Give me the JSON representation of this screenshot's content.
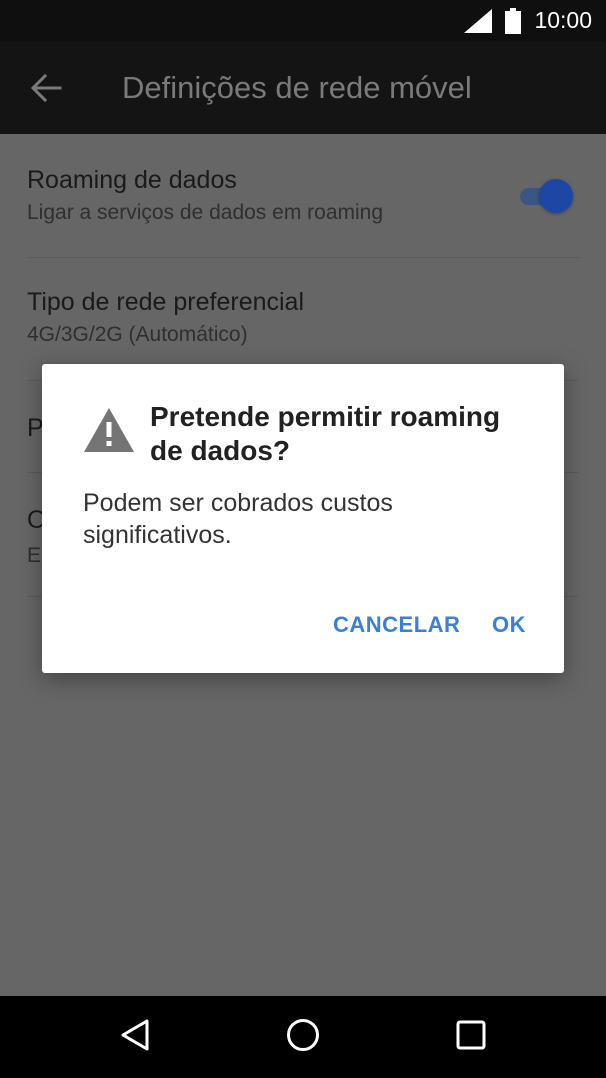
{
  "status_bar": {
    "time": "10:00",
    "signal_icon": "signal-icon",
    "battery_icon": "battery-icon"
  },
  "app_bar": {
    "back_icon": "arrow-left-icon",
    "title": "Definições de rede móvel"
  },
  "settings": [
    {
      "title": "Roaming de dados",
      "summary": "Ligar a serviços de dados em roaming",
      "toggle_on": true
    },
    {
      "title": "Tipo de rede preferencial",
      "summary": "4G/3G/2G (Automático)"
    }
  ],
  "obscured": {
    "item3_initial": "P",
    "item4_initial": "O",
    "item4_summary_initial": "E"
  },
  "dialog": {
    "icon": "warning-icon",
    "title": "Pretende permitir roaming de dados?",
    "message": "Podem ser cobrados custos significativos.",
    "cancel_label": "CANCELAR",
    "ok_label": "OK"
  },
  "nav_bar": {
    "back": "back-triangle-icon",
    "home": "home-circle-icon",
    "recents": "recents-square-icon"
  },
  "colors": {
    "accent": "#3c7fd7",
    "toggle": "#1d46a5",
    "scrim": "#666666"
  }
}
